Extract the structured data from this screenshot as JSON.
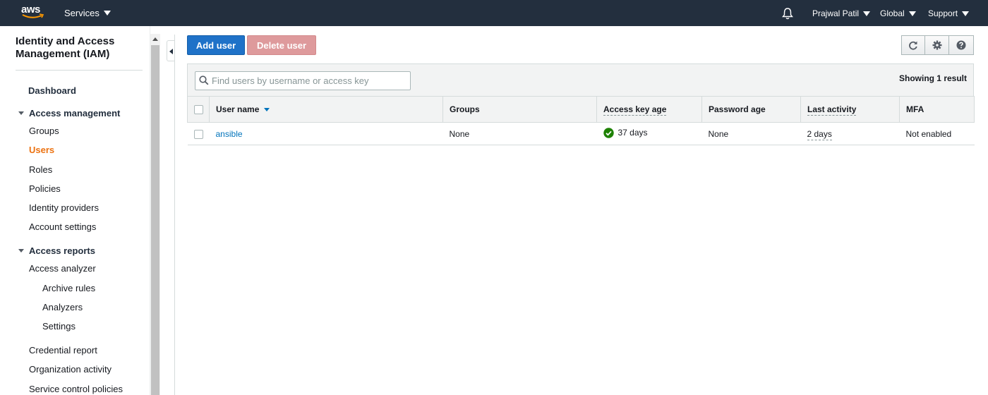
{
  "topnav": {
    "logo_text": "aws",
    "services_label": "Services",
    "user_label": "Prajwal Patil",
    "region_label": "Global",
    "support_label": "Support"
  },
  "sidebar": {
    "title": "Identity and Access Management (IAM)",
    "dashboard": "Dashboard",
    "access_management": {
      "label": "Access management",
      "items": [
        "Groups",
        "Users",
        "Roles",
        "Policies",
        "Identity providers",
        "Account settings"
      ],
      "active": "Users"
    },
    "access_reports": {
      "label": "Access reports",
      "analyzer": "Access analyzer",
      "sub_items": [
        "Archive rules",
        "Analyzers",
        "Settings"
      ],
      "items": [
        "Credential report",
        "Organization activity",
        "Service control policies"
      ]
    }
  },
  "toolbar": {
    "add_user": "Add user",
    "delete_user": "Delete user",
    "icons": [
      "refresh-icon",
      "gear-icon",
      "help-icon"
    ]
  },
  "search": {
    "placeholder": "Find users by username or access key",
    "value": ""
  },
  "results": {
    "showing": "Showing 1 result"
  },
  "table": {
    "columns": [
      "User name",
      "Groups",
      "Access key age",
      "Password age",
      "Last activity",
      "MFA"
    ],
    "sorted_column": "User name",
    "rows": [
      {
        "user_name": "ansible",
        "groups": "None",
        "access_key_age": "37 days",
        "access_key_status": "check-circle-icon",
        "password_age": "None",
        "last_activity": "2 days",
        "mfa": "Not enabled"
      }
    ]
  },
  "colors": {
    "nav_bg": "#232f3e",
    "primary": "#1f72c8",
    "active_nav": "#ec7211",
    "link": "#0073bb",
    "success": "#1d8102"
  }
}
